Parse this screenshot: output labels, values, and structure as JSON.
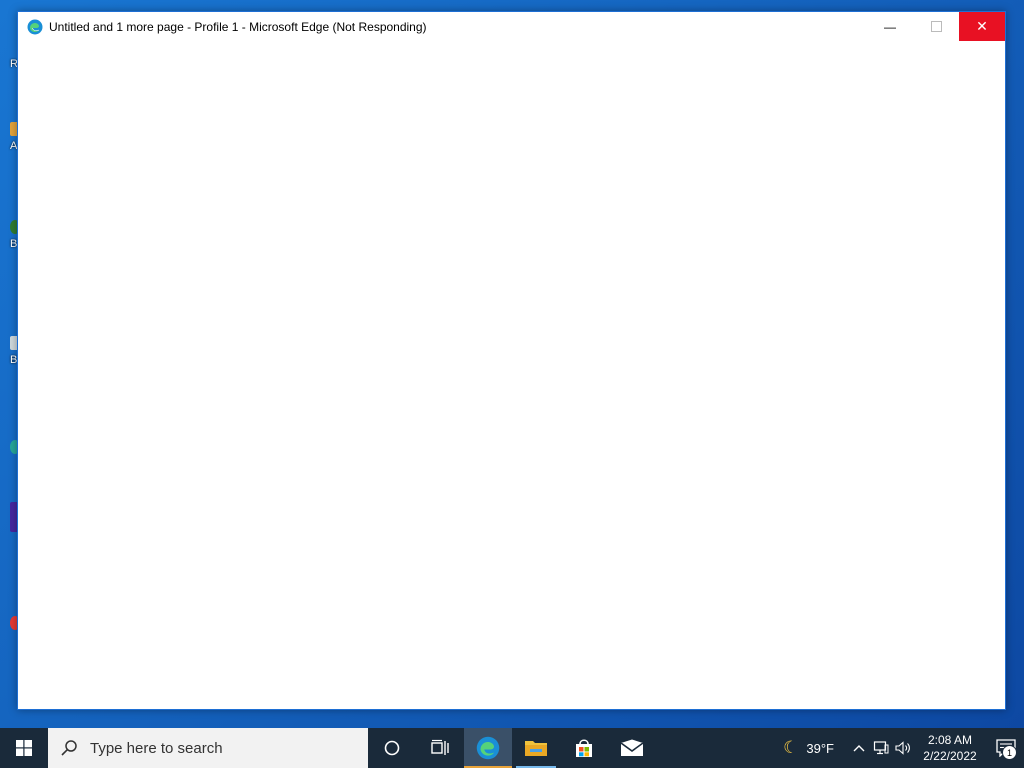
{
  "window": {
    "title": "Untitled and 1 more page - Profile 1 - Microsoft Edge (Not Responding)",
    "controls": {
      "minimize": "—",
      "maximize": "",
      "close": "✕"
    }
  },
  "desktop": {
    "partial_labels": [
      "R",
      "A",
      "B",
      "B"
    ]
  },
  "taskbar": {
    "search_placeholder": "Type here to search",
    "pinned": [
      "task-view",
      "edge",
      "file-explorer",
      "microsoft-store",
      "mail"
    ],
    "weather": {
      "temp": "39°F",
      "icon": "moon-icon"
    },
    "clock": {
      "time": "2:08 AM",
      "date": "2/22/2022"
    },
    "notification_count": "1"
  },
  "colors": {
    "close_button": "#e81123",
    "taskbar": "#1a2a3a",
    "desktop": "#1565c0"
  }
}
